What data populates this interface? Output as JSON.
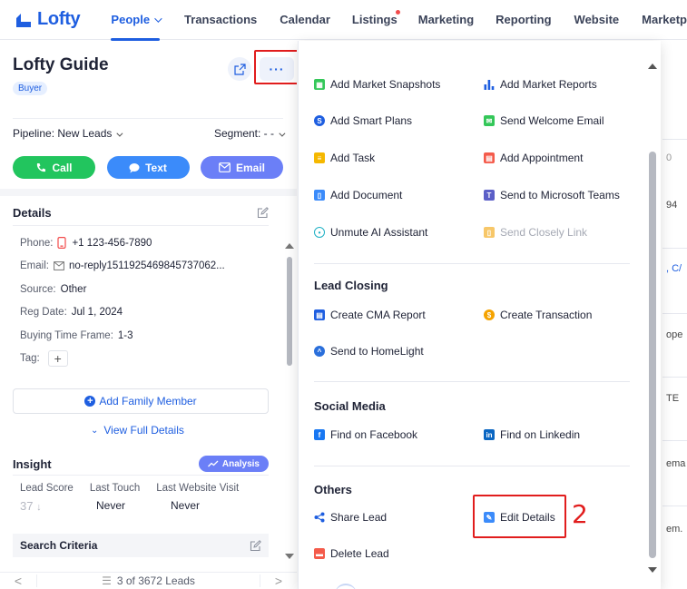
{
  "brand": {
    "name": "Lofty",
    "color": "#1e5ee0"
  },
  "nav": {
    "items": [
      {
        "label": "People",
        "active": true,
        "has_caret": true
      },
      {
        "label": "Transactions"
      },
      {
        "label": "Calendar"
      },
      {
        "label": "Listings",
        "has_dot": true
      },
      {
        "label": "Marketing"
      },
      {
        "label": "Reporting"
      },
      {
        "label": "Website"
      },
      {
        "label": "Marketp"
      }
    ]
  },
  "lead": {
    "name": "Lofty Guide",
    "badge": "Buyer",
    "more_label": "···",
    "pipeline_label": "Pipeline: New Leads",
    "segment_label": "Segment: - -",
    "actions": {
      "call": "Call",
      "text": "Text",
      "email": "Email"
    }
  },
  "details": {
    "title": "Details",
    "phone_label": "Phone:",
    "phone": "+1 123-456-7890",
    "email_label": "Email:",
    "email": "no-reply1511925469845737062...",
    "source_label": "Source:",
    "source": "Other",
    "reg_label": "Reg Date:",
    "reg_date": "Jul 1, 2024",
    "buying_label": "Buying Time Frame:",
    "buying": "1-3",
    "tag_label": "Tag:",
    "add_family": "Add Family Member",
    "view_full": "View Full Details"
  },
  "insight": {
    "title": "Insight",
    "analysis": "Analysis",
    "col1": "Lead Score",
    "col2": "Last Touch",
    "col3": "Last Website Visit",
    "score": "37",
    "last_touch": "Never",
    "last_visit": "Never",
    "search_criteria": "Search Criteria"
  },
  "pager": {
    "text": "3 of 3672 Leads",
    "prev": "<",
    "next": ">"
  },
  "annotations": {
    "step1": "1",
    "step2": "2",
    "highlight_color": "#e11d1d"
  },
  "menu": {
    "items": {
      "add_market_snapshots": "Add Market Snapshots",
      "add_market_reports": "Add Market Reports",
      "add_smart_plans": "Add Smart Plans",
      "send_welcome_email": "Send Welcome Email",
      "add_task": "Add Task",
      "add_appointment": "Add Appointment",
      "add_document": "Add Document",
      "send_to_teams": "Send to Microsoft Teams",
      "unmute_ai": "Unmute AI Assistant",
      "send_closely": "Send Closely Link"
    },
    "lead_closing": {
      "title": "Lead Closing",
      "create_cma": "Create CMA Report",
      "create_transaction": "Create Transaction",
      "send_homelight": "Send to HomeLight"
    },
    "social": {
      "title": "Social Media",
      "facebook": "Find on Facebook",
      "linkedin": "Find on Linkedin"
    },
    "others": {
      "title": "Others",
      "share_lead": "Share Lead",
      "edit_details": "Edit Details",
      "delete_lead": "Delete Lead"
    }
  },
  "background_right": {
    "snippets": [
      "0",
      "94",
      ", C/",
      "ope",
      "TE",
      "ema",
      "em."
    ]
  }
}
